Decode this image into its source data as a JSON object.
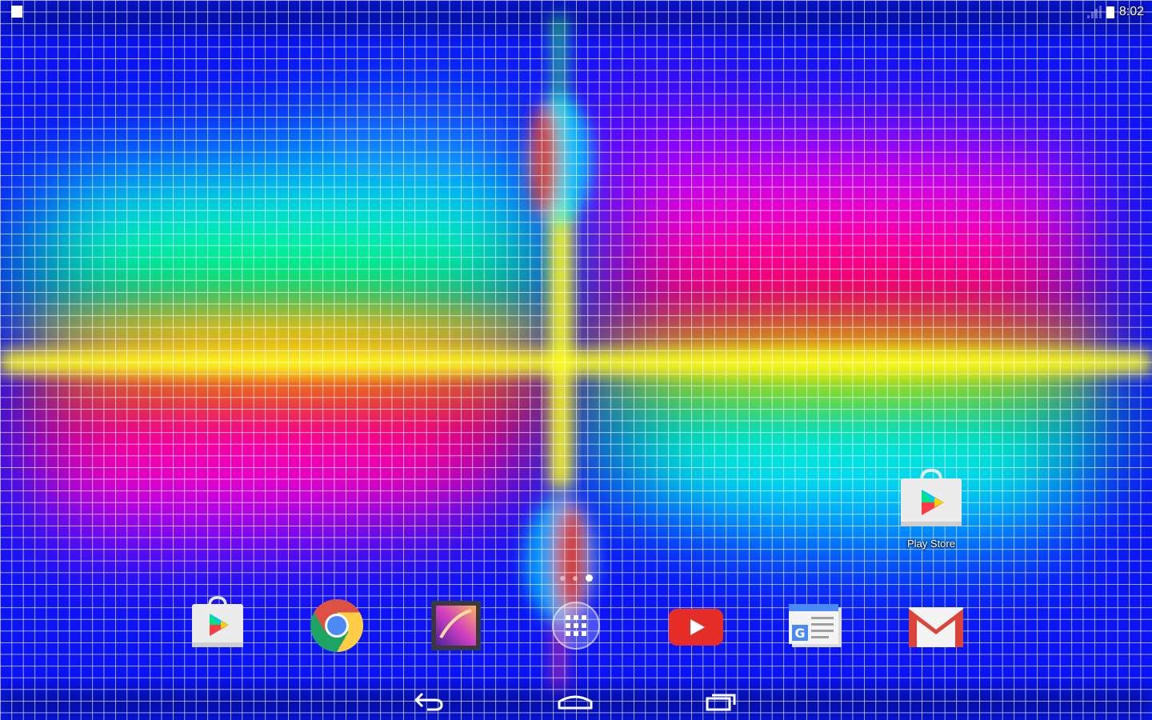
{
  "status_bar": {
    "time": "8:02"
  },
  "home_screen": {
    "desktop_apps": [
      {
        "label": "Play Store",
        "icon": "play-store-icon"
      }
    ],
    "page_indicator": {
      "pages": 3,
      "current": 3
    }
  },
  "dock": {
    "apps": [
      {
        "icon": "play-store-icon"
      },
      {
        "icon": "chrome-icon"
      },
      {
        "icon": "gallery-icon"
      },
      {
        "icon": "app-drawer-icon"
      },
      {
        "icon": "youtube-icon"
      },
      {
        "icon": "google-news-icon"
      },
      {
        "icon": "gmail-icon"
      }
    ]
  },
  "nav_bar": {
    "buttons": [
      {
        "icon": "back-icon"
      },
      {
        "icon": "home-icon"
      },
      {
        "icon": "recents-icon"
      }
    ]
  },
  "colors": {
    "wallpaper_base": "#0010f0",
    "grid_line": "#ffffff"
  }
}
